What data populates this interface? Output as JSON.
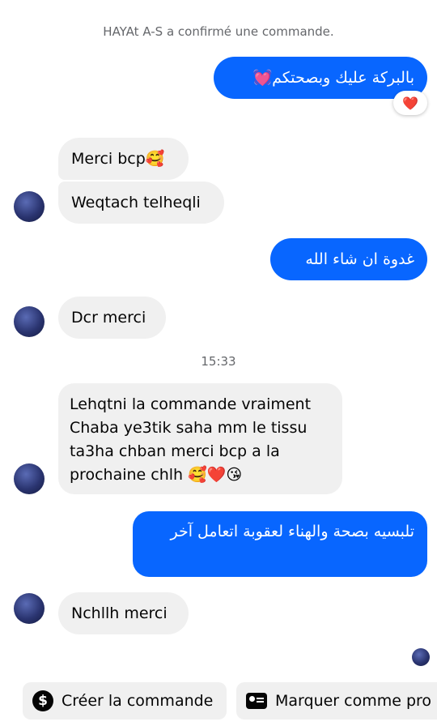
{
  "system_message": "HAYAt A-S a confirmé une commande.",
  "messages": [
    {
      "text": "بالبركة عليك وبصحتكم💓",
      "reaction": "❤️"
    },
    {
      "text": "Merci bcp🥰"
    },
    {
      "text": "Weqtach telheqli"
    },
    {
      "text": "غدوة ان شاء الله"
    },
    {
      "text": "Dcr merci"
    },
    {
      "text": "Lehqtni la commande vraiment Chaba ye3tik saha mm le tissu ta3ha chban merci bcp a la prochaine chlh 🥰❤️😘"
    },
    {
      "text": "تلبسيه بصحة والهناء لعقوبة اتعامل آخر"
    },
    {
      "text": "Nchllh merci"
    }
  ],
  "timestamp": "15:33",
  "actions": {
    "create_order": {
      "label": "Créer la commande",
      "icon": "dollar-icon"
    },
    "mark_as": {
      "label": "Marquer comme pro",
      "icon": "id-card-icon"
    }
  },
  "colors": {
    "outgoing_bubble": "#0866ff",
    "incoming_bubble": "#f0f0f0",
    "meta_text": "#65676b"
  }
}
